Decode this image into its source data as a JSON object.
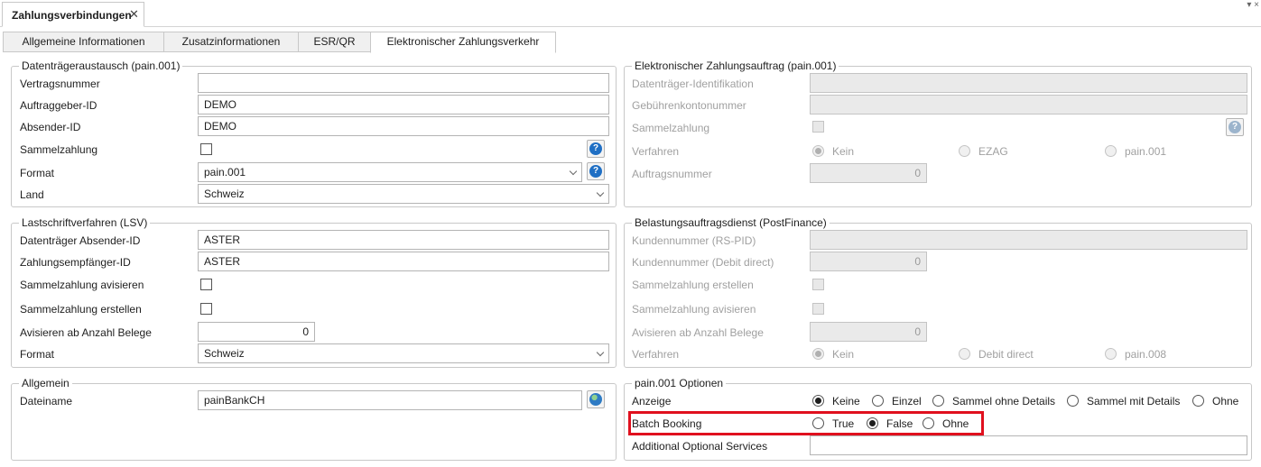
{
  "doc_tab": {
    "title": "Zahlungsverbindungen",
    "close_icon": "close-icon"
  },
  "window_controls": "▾ ×",
  "tabs": [
    {
      "label": "Allgemeine Informationen",
      "active": false
    },
    {
      "label": "Zusatzinformationen",
      "active": false
    },
    {
      "label": "ESR/QR",
      "active": false
    },
    {
      "label": "Elektronischer Zahlungsverkehr",
      "active": true
    }
  ],
  "dta": {
    "title": "Datenträgeraustausch (pain.001)",
    "vertragsnummer_label": "Vertragsnummer",
    "vertragsnummer_value": "",
    "auftraggeber_label": "Auftraggeber-ID",
    "auftraggeber_value": "DEMO",
    "absender_label": "Absender-ID",
    "absender_value": "DEMO",
    "sammelzahlung_label": "Sammelzahlung",
    "format_label": "Format",
    "format_value": "pain.001",
    "land_label": "Land",
    "land_value": "Schweiz",
    "help_glyph": "?"
  },
  "ezag": {
    "title": "Elektronischer Zahlungsauftrag (pain.001)",
    "datentraeger_label": "Datenträger-Identifikation",
    "datentraeger_value": "",
    "gebuehren_label": "Gebührenkontonummer",
    "gebuehren_value": "",
    "sammelzahlung_label": "Sammelzahlung",
    "verfahren_label": "Verfahren",
    "verfahren_options": [
      "Kein",
      "EZAG",
      "pain.001"
    ],
    "verfahren_selected": "Kein",
    "auftragsnummer_label": "Auftragsnummer",
    "auftragsnummer_value": "0"
  },
  "lsv": {
    "title": "Lastschriftverfahren (LSV)",
    "absender_label": "Datenträger Absender-ID",
    "absender_value": "ASTER",
    "empfaenger_label": "Zahlungsempfänger-ID",
    "empfaenger_value": "ASTER",
    "avisieren_label": "Sammelzahlung avisieren",
    "erstellen_label": "Sammelzahlung erstellen",
    "anzahl_label": "Avisieren ab Anzahl Belege",
    "anzahl_value": "0",
    "format_label": "Format",
    "format_value": "Schweiz"
  },
  "postfinance": {
    "title": "Belastungsauftragsdienst (PostFinance)",
    "kunden_rs_label": "Kundennummer (RS-PID)",
    "kunden_rs_value": "",
    "kunden_dd_label": "Kundennummer (Debit direct)",
    "kunden_dd_value": "0",
    "erstellen_label": "Sammelzahlung erstellen",
    "avisieren_label": "Sammelzahlung avisieren",
    "anzahl_label": "Avisieren ab Anzahl Belege",
    "anzahl_value": "0",
    "verfahren_label": "Verfahren",
    "verfahren_options": [
      "Kein",
      "Debit direct",
      "pain.008"
    ],
    "verfahren_selected": "Kein"
  },
  "allgemein": {
    "title": "Allgemein",
    "dateiname_label": "Dateiname",
    "dateiname_value": "painBankCH",
    "globe_icon": "globe-icon"
  },
  "pain_options": {
    "title": "pain.001 Optionen",
    "anzeige_label": "Anzeige",
    "anzeige_options": [
      "Keine",
      "Einzel",
      "Sammel ohne Details",
      "Sammel mit Details",
      "Ohne"
    ],
    "anzeige_selected": "Keine",
    "batch_label": "Batch Booking",
    "batch_options": [
      "True",
      "False",
      "Ohne"
    ],
    "batch_selected": "False",
    "additional_label": "Additional Optional Services",
    "additional_value": ""
  },
  "colors": {
    "highlight": "#e0101e",
    "help_blue": "#1f6fc4"
  }
}
